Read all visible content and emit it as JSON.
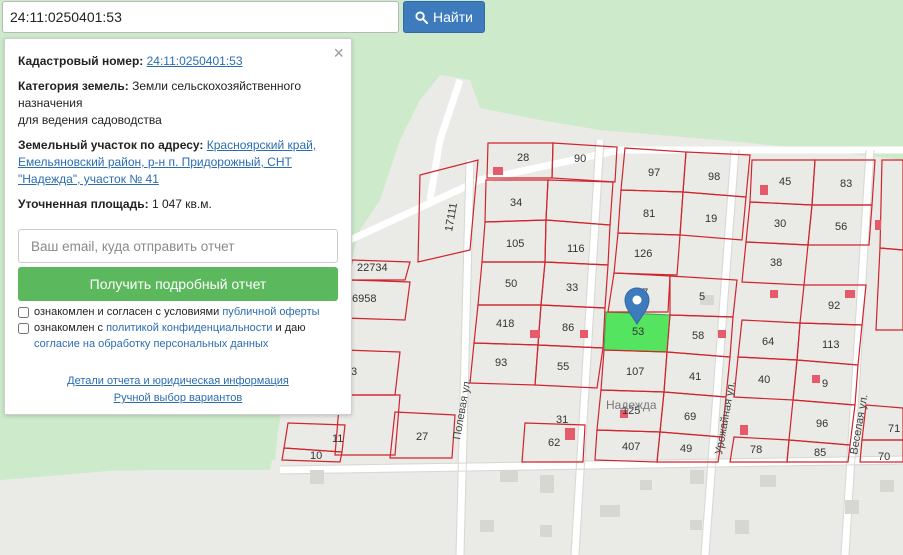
{
  "search": {
    "value": "24:11:0250401:53",
    "button_label": "Найти",
    "button_icon": "search-icon"
  },
  "panel": {
    "close_glyph": "×",
    "cadastral_label": "Кадастровый номер:",
    "cadastral_value": "24:11:0250401:53",
    "category_label": "Категория земель:",
    "category_line1": "Земли сельскохозяйственного",
    "category_line2": "назначения",
    "category_line3": "для ведения садоводства",
    "address_label": "Земельный участок по адресу:",
    "address_line1": "Красноярский край,",
    "address_line2": "Емельяновский район, р-н п. Придорожный, СНТ",
    "address_line3": "\"Надежда\", участок № 41",
    "area_label": "Уточненная площадь:",
    "area_value": "1 047 кв.м.",
    "email_placeholder": "Ваш email, куда отправить отчет",
    "report_button": "Получить подробный отчет",
    "consent1_text": "ознакомлен и согласен с условиями",
    "consent1_link": "публичной оферты",
    "consent2_text": "ознакомлен с",
    "consent2_link": "политикой конфиденциальности",
    "consent2_tail": "и даю",
    "consent2_link2": "согласие на обработку персональных данных",
    "details_link": "Детали отчета и юридическая информация",
    "manual_link": "Ручной выбор вариантов"
  },
  "map": {
    "colors": {
      "forest": "#cdeacb",
      "ground": "#eaeae6",
      "plot_border": "#d0242e",
      "highlight": "#55e45f",
      "building": "#e55b6b",
      "marker": "#3d7bbd"
    },
    "selected_plot": "41",
    "snt_name": "Надежда",
    "streets": [
      "Полевая ул.",
      "Урожайная ул.",
      "Веселая ул."
    ],
    "plots": [
      "28",
      "90",
      "97",
      "98",
      "45",
      "83",
      "17111",
      "34",
      "81",
      "19",
      "30",
      "56",
      "105",
      "116",
      "126",
      "38",
      "22734",
      "50",
      "33",
      "17",
      "5",
      "92",
      "6958",
      "418",
      "86",
      "58",
      "64",
      "113",
      "93",
      "55",
      "107",
      "41",
      "40",
      "9",
      "3",
      "31",
      "125",
      "69",
      "96",
      "71",
      "11",
      "27",
      "62",
      "407",
      "49",
      "78",
      "85",
      "70",
      "10",
      "53"
    ]
  }
}
